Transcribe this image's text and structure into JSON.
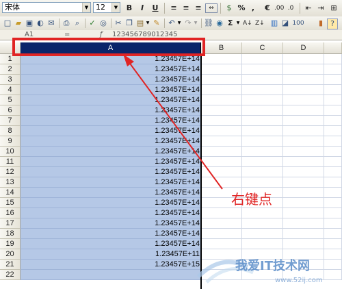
{
  "toolbar_format": {
    "font_name": "宋体",
    "font_size": "12",
    "bold": "B",
    "italic": "I",
    "underline": "U",
    "percent": "%",
    "comma": ",",
    "euro": "€"
  },
  "toolbar_standard": {
    "sigma": "Σ",
    "sort_asc": "A↓",
    "sort_desc": "Z↓"
  },
  "formula_bar": {
    "name_box": "A1",
    "eq": "=",
    "fx": "f",
    "value": "123456789012345"
  },
  "columns": [
    "A",
    "B",
    "C",
    "D"
  ],
  "rows": [
    {
      "num": "1",
      "value": "1.23457E+14"
    },
    {
      "num": "2",
      "value": "1.23457E+14"
    },
    {
      "num": "3",
      "value": "1.23457E+14"
    },
    {
      "num": "4",
      "value": "1.23457E+14"
    },
    {
      "num": "5",
      "value": "1.23457E+14"
    },
    {
      "num": "6",
      "value": "1.23457E+14"
    },
    {
      "num": "7",
      "value": "1.23457E+14"
    },
    {
      "num": "8",
      "value": "1.23457E+14"
    },
    {
      "num": "9",
      "value": "1.23457E+14"
    },
    {
      "num": "10",
      "value": "1.23457E+14"
    },
    {
      "num": "11",
      "value": "1.23457E+14"
    },
    {
      "num": "12",
      "value": "1.23457E+14"
    },
    {
      "num": "13",
      "value": "1.23457E+14"
    },
    {
      "num": "14",
      "value": "1.23457E+14"
    },
    {
      "num": "15",
      "value": "1.23457E+14"
    },
    {
      "num": "16",
      "value": "1.23457E+14"
    },
    {
      "num": "17",
      "value": "1.23457E+14"
    },
    {
      "num": "18",
      "value": "1.23457E+14"
    },
    {
      "num": "19",
      "value": "1.23457E+14"
    },
    {
      "num": "20",
      "value": "1.23457E+11"
    },
    {
      "num": "21",
      "value": "1.23457E+15"
    },
    {
      "num": "22",
      "value": ""
    }
  ],
  "annotation": {
    "text": "右键点",
    "color": "#e02424"
  },
  "watermark": {
    "text": "我爱IT技术网",
    "url": "www.52ij.com"
  },
  "colors": {
    "selected_header": "#0a246a",
    "selection_fill": "#b5c8e6",
    "highlight_red": "#e02424"
  }
}
